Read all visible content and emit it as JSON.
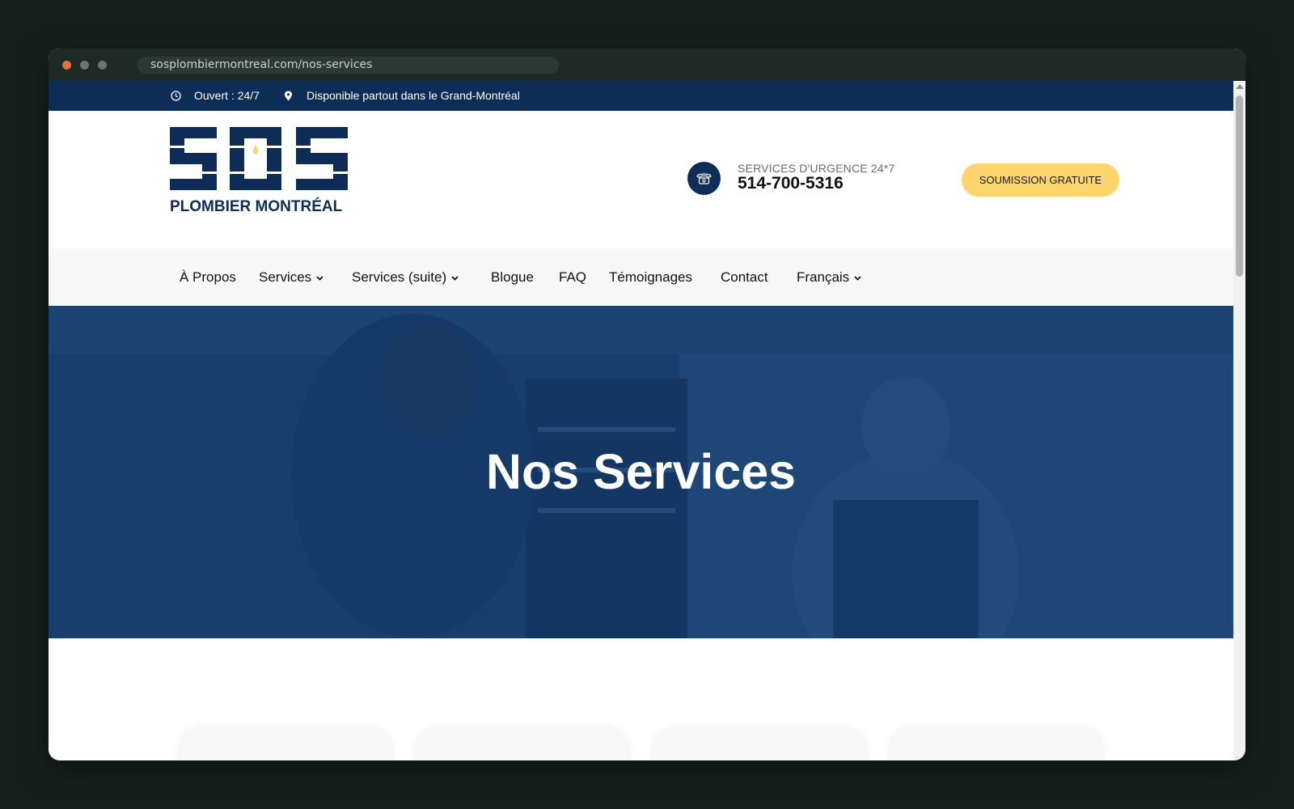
{
  "browser": {
    "url": "sosplombiermontreal.com/nos-services"
  },
  "topbar": {
    "hours": "Ouvert : 24/7",
    "area": "Disponible partout dans le Grand-Montréal"
  },
  "header": {
    "logo_text": "SOS",
    "logo_subtitle": "PLOMBIER MONTRÉAL",
    "emergency_label": "SERVICES D'URGENCE 24*7",
    "phone": "514-700-5316",
    "cta_label": "SOUMISSION GRATUITE"
  },
  "nav": {
    "items": [
      {
        "label": "À Propos"
      },
      {
        "label": "Services"
      },
      {
        "label": "Services (suite)"
      },
      {
        "label": "Blogue"
      },
      {
        "label": "FAQ"
      },
      {
        "label": "Témoignages"
      },
      {
        "label": "Contact"
      },
      {
        "label": "Français"
      }
    ]
  },
  "hero": {
    "title": "Nos Services"
  },
  "colors": {
    "navy": "#0e2d56",
    "accent_yellow": "#fdd56d",
    "hero_overlay": "#1a3f6e"
  }
}
